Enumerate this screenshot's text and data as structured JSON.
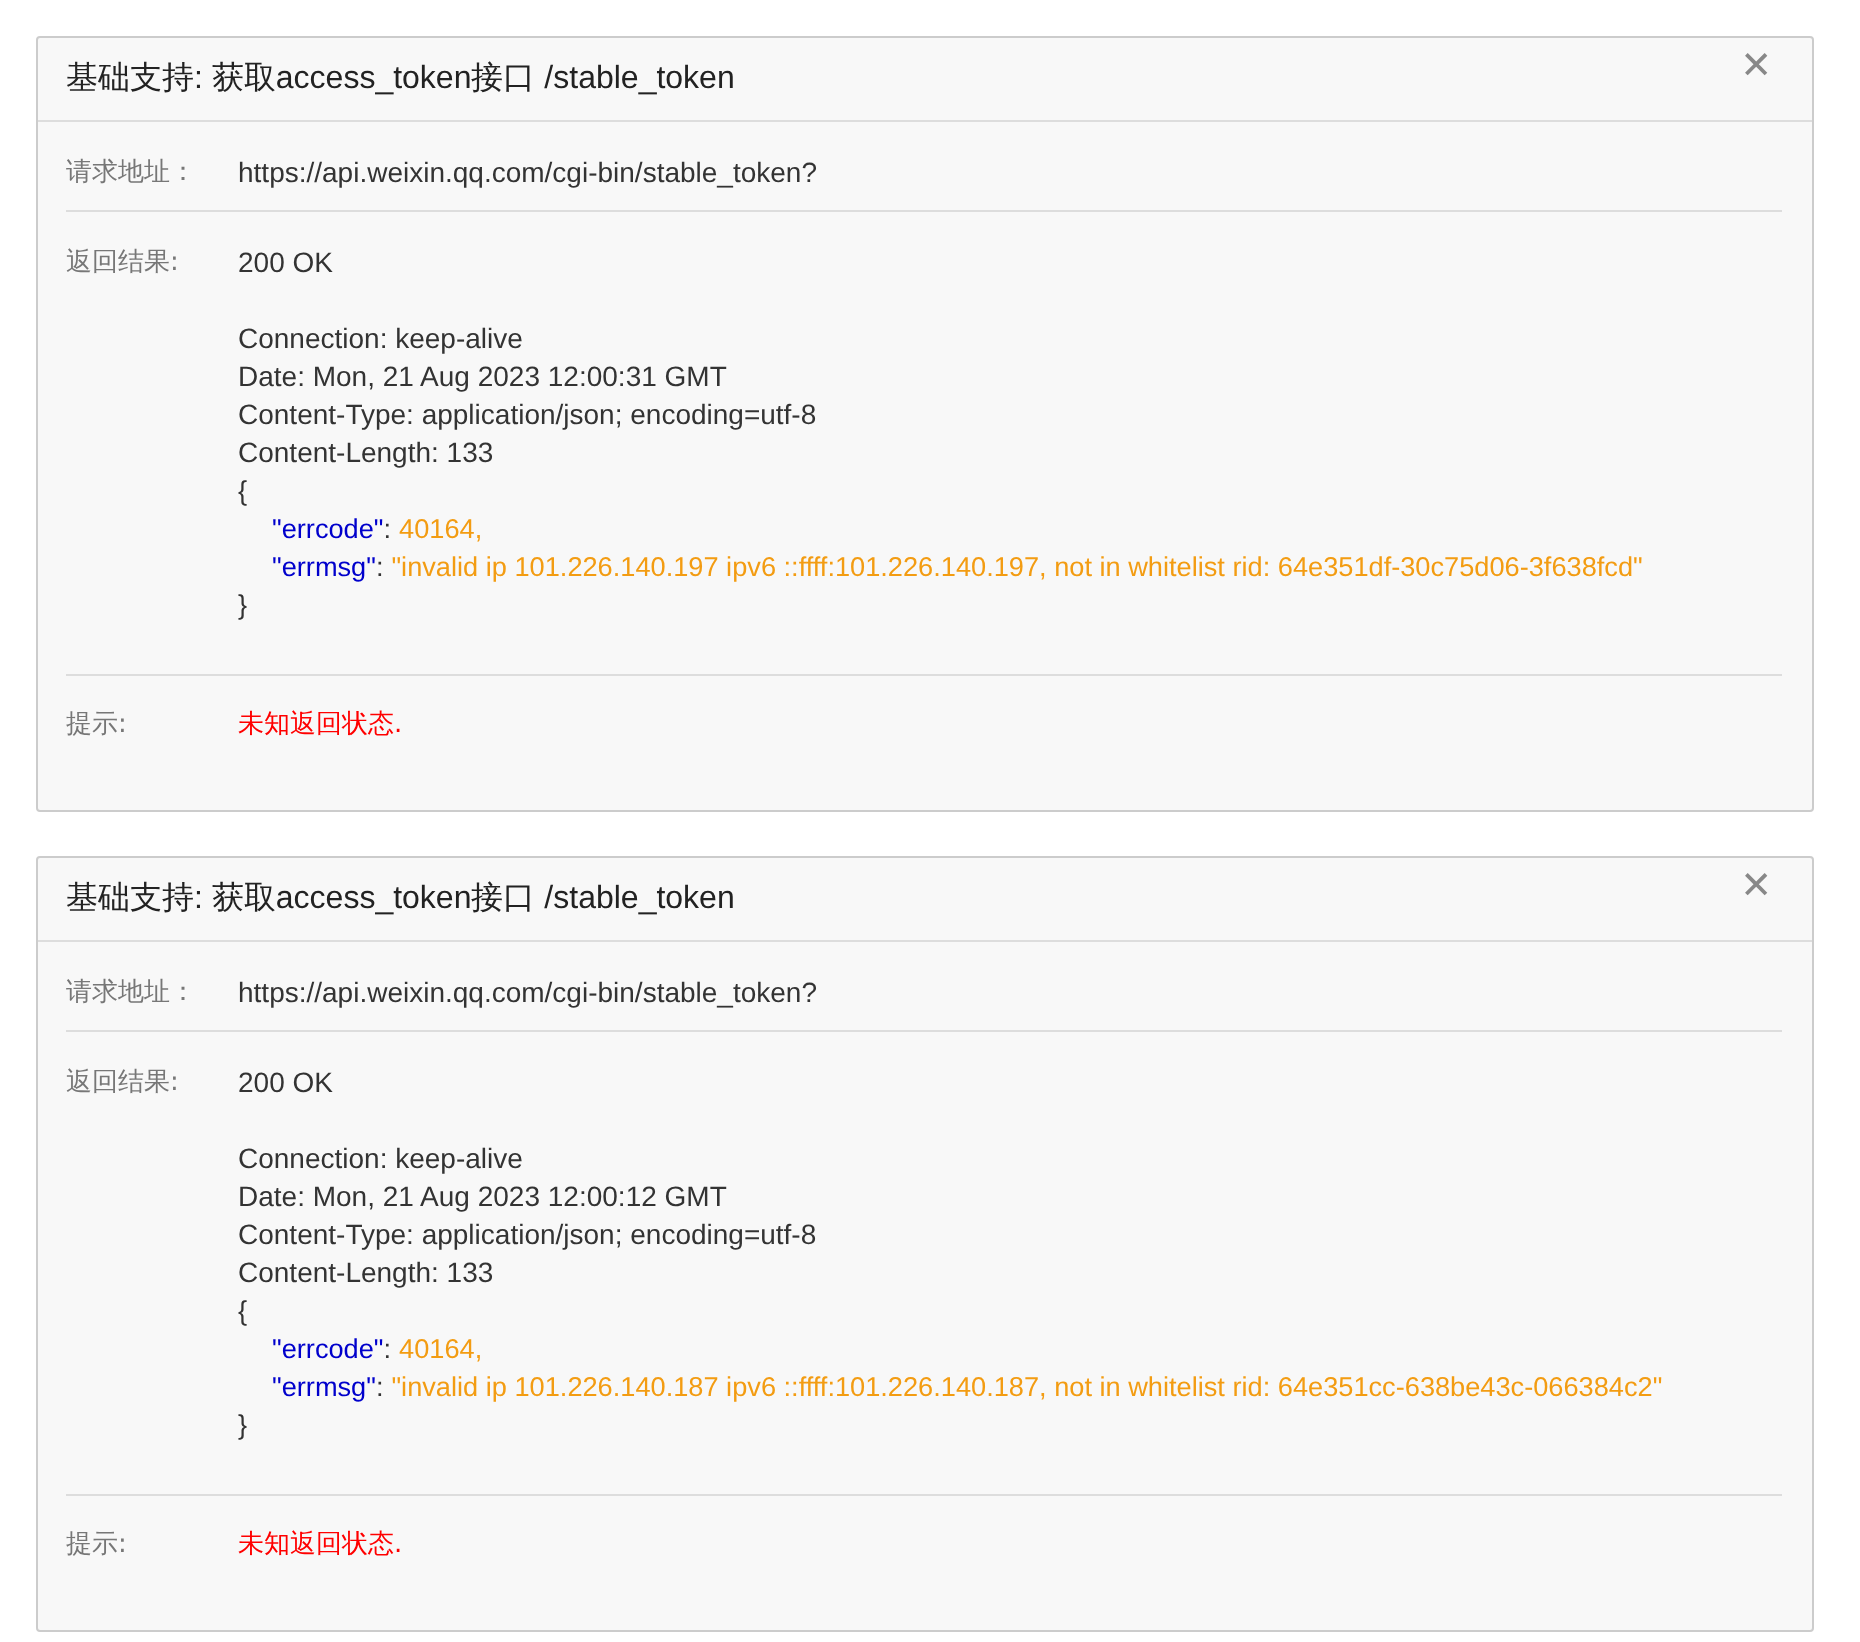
{
  "panels": [
    {
      "title": "基础支持: 获取access_token接口 /stable_token",
      "close": "✕",
      "url_label": "请求地址：",
      "url": "https://api.weixin.qq.com/cgi-bin/stable_token?",
      "result_label": "返回结果:",
      "status": "200 OK",
      "headers": [
        "Connection: keep-alive",
        "Date: Mon, 21 Aug 2023 12:00:31 GMT",
        "Content-Type: application/json; encoding=utf-8",
        "Content-Length: 133"
      ],
      "open_brace": "{",
      "fields": [
        {
          "key": "\"errcode\"",
          "colon": ":",
          "value": "40164,"
        },
        {
          "key": "\"errmsg\"",
          "colon": ":",
          "value": "\"invalid ip 101.226.140.197 ipv6 ::ffff:101.226.140.197, not in whitelist rid: 64e351df-30c75d06-3f638fcd\""
        }
      ],
      "close_brace": "}",
      "tip_label": "提示:",
      "tip": "未知返回状态."
    },
    {
      "title": "基础支持: 获取access_token接口 /stable_token",
      "close": "✕",
      "url_label": "请求地址：",
      "url": "https://api.weixin.qq.com/cgi-bin/stable_token?",
      "result_label": "返回结果:",
      "status": "200 OK",
      "headers": [
        "Connection: keep-alive",
        "Date: Mon, 21 Aug 2023 12:00:12 GMT",
        "Content-Type: application/json; encoding=utf-8",
        "Content-Length: 133"
      ],
      "open_brace": "{",
      "fields": [
        {
          "key": "\"errcode\"",
          "colon": ":",
          "value": "40164,"
        },
        {
          "key": "\"errmsg\"",
          "colon": ":",
          "value": "\"invalid ip 101.226.140.187 ipv6 ::ffff:101.226.140.187, not in whitelist rid: 64e351cc-638be43c-066384c2\""
        }
      ],
      "close_brace": "}",
      "tip_label": "提示:",
      "tip": "未知返回状态."
    }
  ]
}
